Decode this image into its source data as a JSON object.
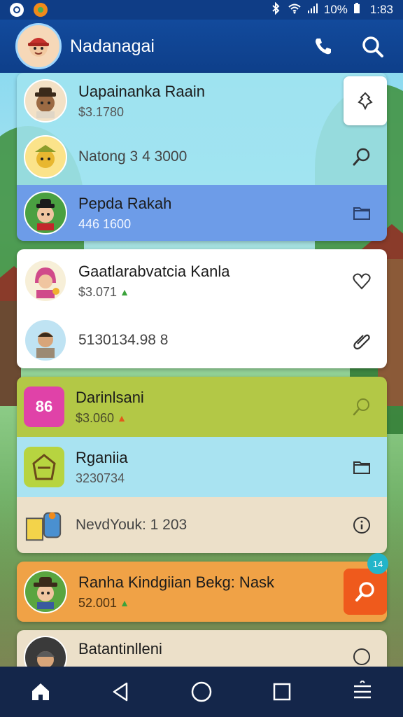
{
  "status_bar": {
    "time": "1:83",
    "battery": "10%",
    "icons": [
      "notification-icon",
      "app-icon",
      "bluetooth-icon",
      "wifi-icon",
      "signal-icon",
      "battery-icon"
    ]
  },
  "header": {
    "title": "Nadanagai",
    "actions": [
      "phone-icon",
      "search-icon"
    ]
  },
  "list": [
    {
      "name": "Uapainanka Raain",
      "sub": "$3.1780",
      "action": "pin-icon",
      "bg": "#a0e4f0"
    },
    {
      "name": "Natong 3 4 3000",
      "sub": "",
      "action": "search-icon",
      "bg": "#a0e4f0"
    },
    {
      "name": "Pepda Rakah",
      "sub": "446 1600",
      "action": "folder-icon",
      "bg": "#6d9ce8"
    },
    {
      "name": "Gaatlarabvatcia Kanla",
      "sub": "$3.071",
      "trend": "up",
      "action": "heart-icon",
      "bg": "#ffffff"
    },
    {
      "name": "5130134.98 8",
      "sub": "",
      "action": "attachment-icon",
      "bg": "#ffffff"
    },
    {
      "name": "Darinlsani",
      "sub": "$3.060",
      "trend": "up-red",
      "action": "search-icon",
      "bg": "#b3c846",
      "badge_text": "86"
    },
    {
      "name": "Rganiia",
      "sub": "3230734",
      "action": "folder-icon",
      "bg": "#a9e3f1"
    },
    {
      "name": "NevdYouk: 1 203",
      "sub": "",
      "action": "info-icon",
      "bg": "#ece0c9"
    },
    {
      "name": "Ranha Kindgiian Bekg: Nask",
      "sub": "52.001",
      "trend": "up",
      "action": "search-icon",
      "bg": "#f0a246",
      "notification": "14"
    },
    {
      "name": "Batantinlleni",
      "sub": "",
      "action": "info-icon",
      "bg": "#ece0c9"
    }
  ],
  "nav": [
    "home-icon",
    "back-icon",
    "home-circle-icon",
    "recents-icon",
    "menu-icon"
  ],
  "colors": {
    "status_bar": "#0f3d86",
    "app_bar": "#124a9c",
    "nav_bar": "#14264a",
    "accent_orange": "#ef5a1c",
    "trend_green": "#3ba33b"
  }
}
